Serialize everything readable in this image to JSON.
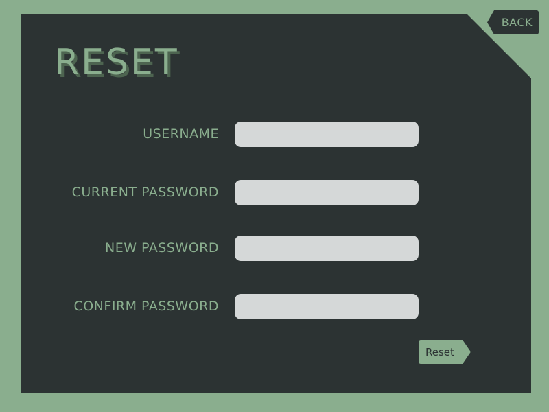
{
  "nav": {
    "back_label": "BACK"
  },
  "form": {
    "title": "RESET",
    "fields": [
      {
        "label": "USERNAME",
        "value": "",
        "placeholder": ""
      },
      {
        "label": "CURRENT PASSWORD",
        "value": "",
        "placeholder": ""
      },
      {
        "label": "NEW PASSWORD",
        "value": "",
        "placeholder": ""
      },
      {
        "label": "CONFIRM PASSWORD",
        "value": "",
        "placeholder": ""
      }
    ],
    "submit_label": "Reset"
  },
  "colors": {
    "background": "#8aae8e",
    "panel": "#2c3333",
    "accent": "#8aae8e",
    "field": "#d5d8d8"
  }
}
